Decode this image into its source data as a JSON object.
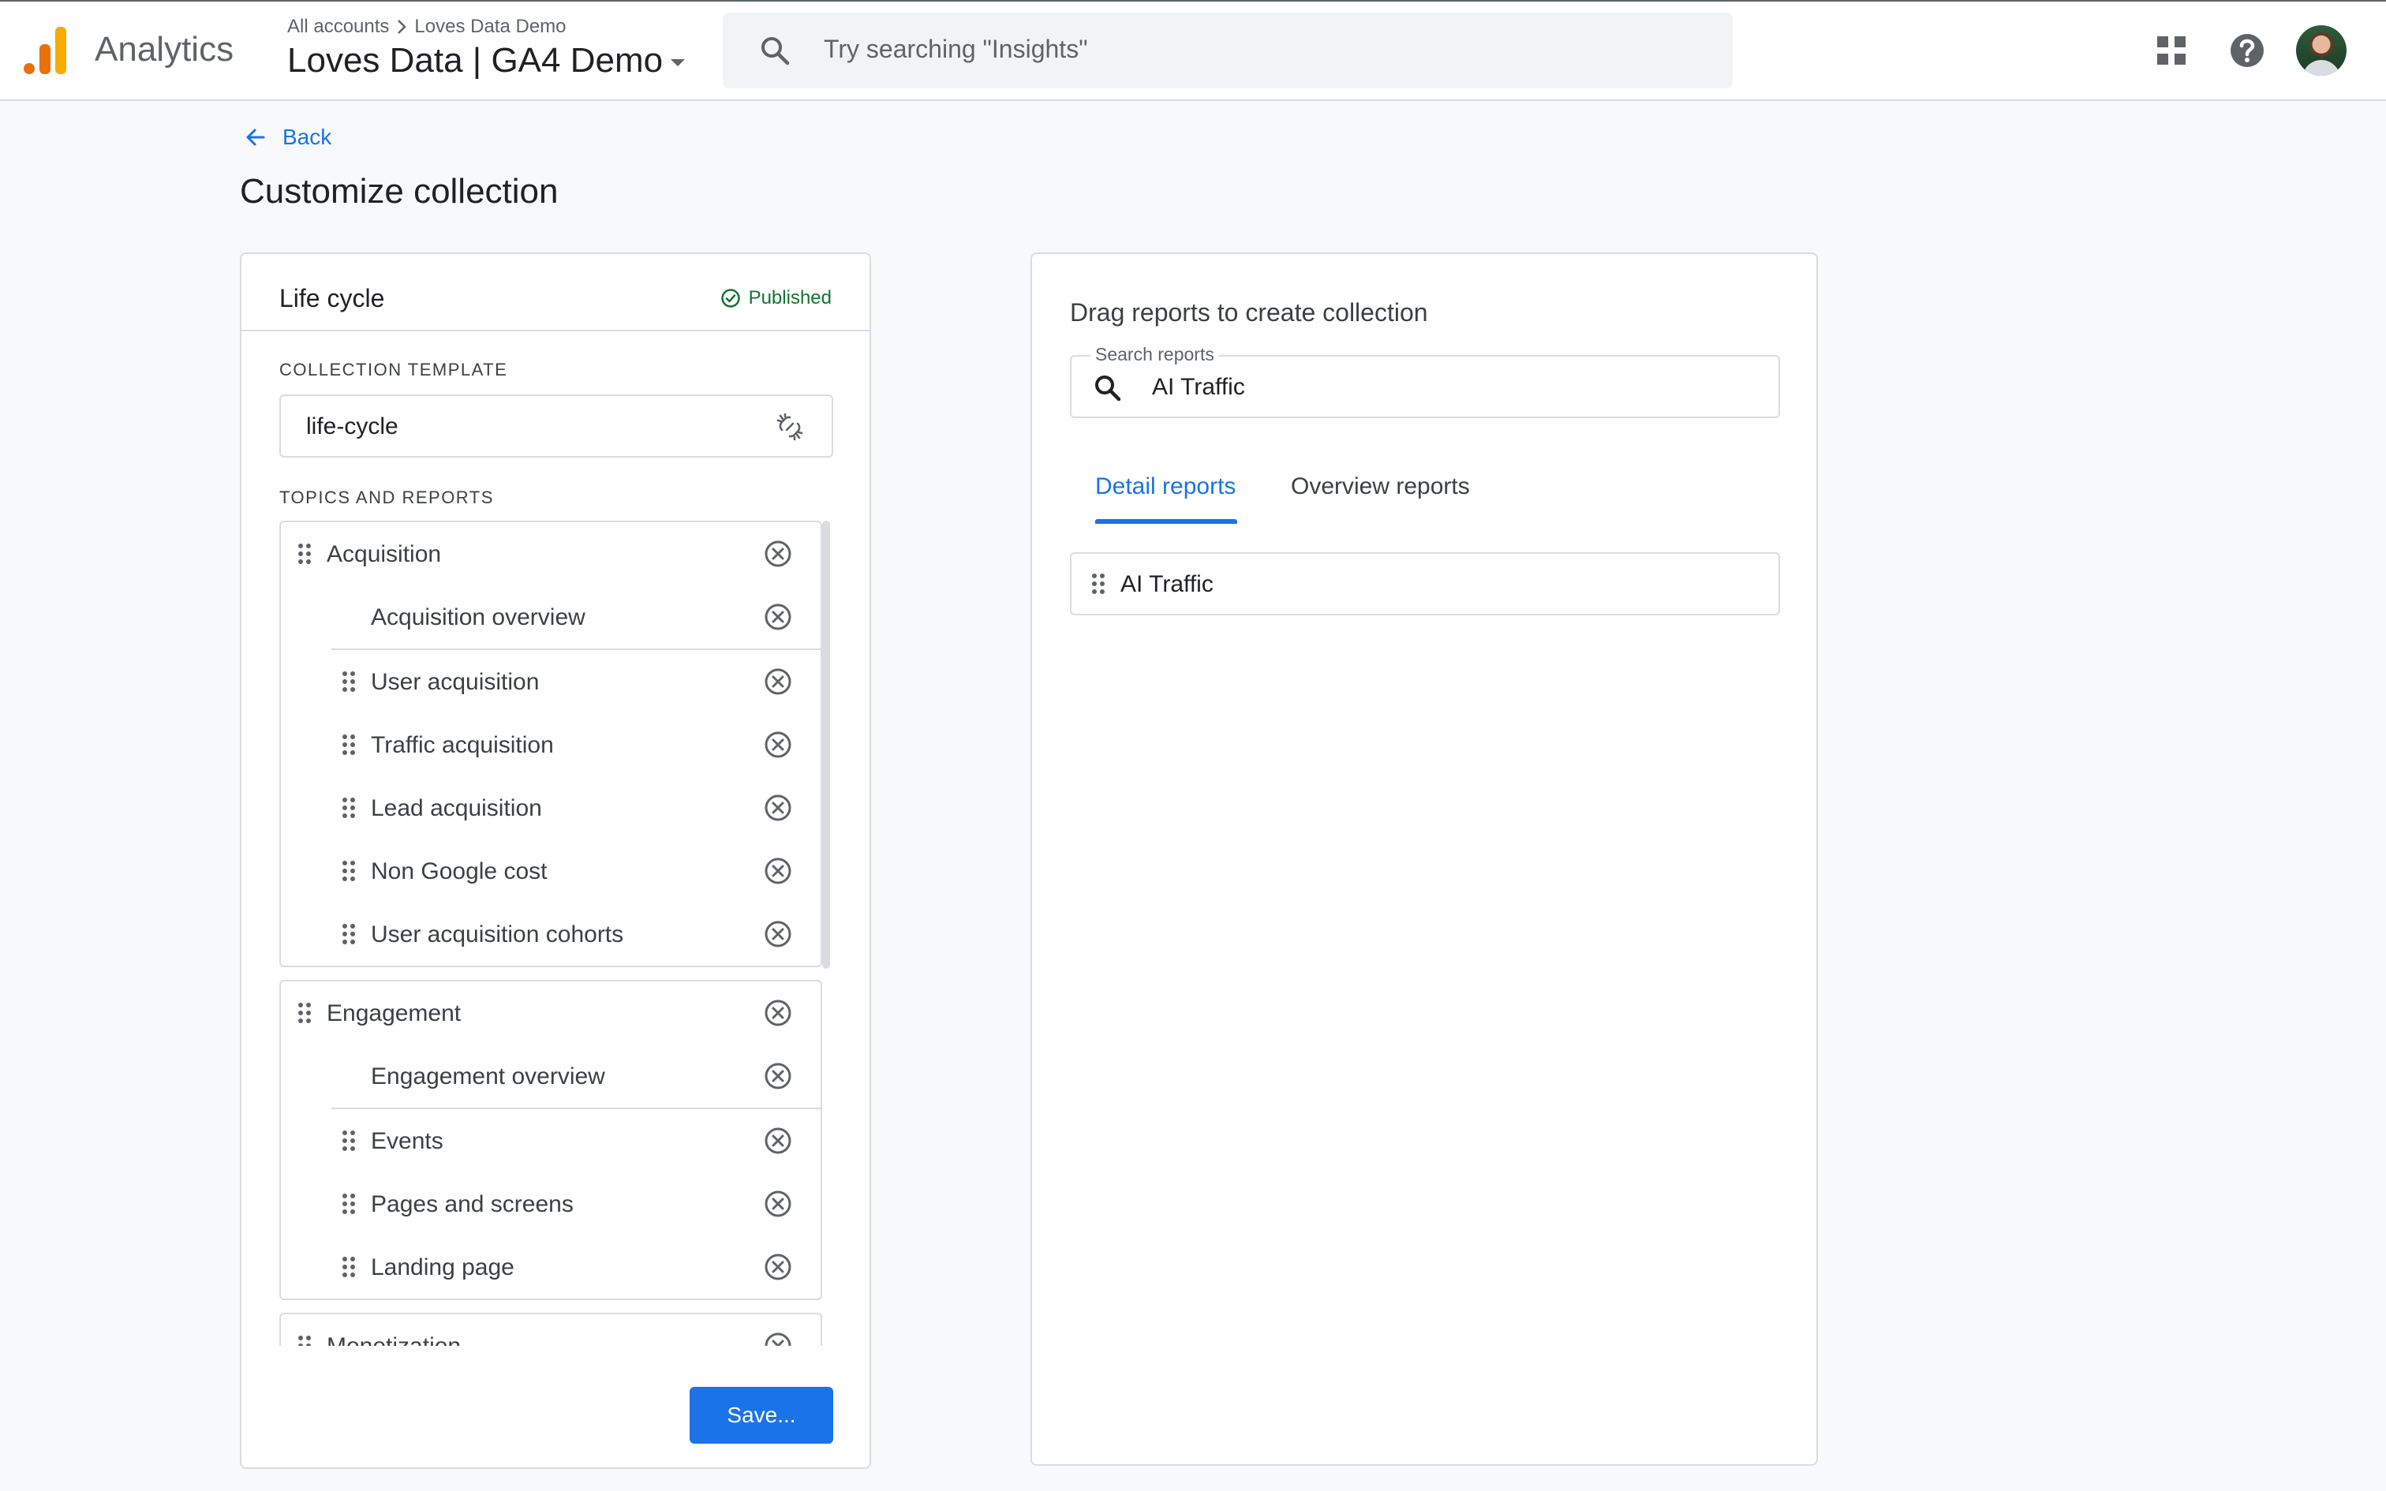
{
  "header": {
    "app_name": "Analytics",
    "breadcrumb": {
      "root": "All accounts",
      "current": "Loves Data Demo"
    },
    "property_name": "Loves Data | GA4 Demo",
    "search_placeholder": "Try searching \"Insights\"",
    "icons": [
      "analytics-logo",
      "search-icon",
      "apps-grid-icon",
      "help-icon",
      "avatar"
    ]
  },
  "page": {
    "back_label": "Back",
    "title": "Customize collection"
  },
  "collection": {
    "name": "Life cycle",
    "status": "Published",
    "template_label": "COLLECTION TEMPLATE",
    "template_value": "life-cycle",
    "topics_label": "TOPICS AND REPORTS",
    "topics": [
      {
        "name": "Acquisition",
        "overview": "Acquisition overview",
        "reports": [
          "User acquisition",
          "Traffic acquisition",
          "Lead acquisition",
          "Non Google cost",
          "User acquisition cohorts"
        ]
      },
      {
        "name": "Engagement",
        "overview": "Engagement overview",
        "reports": [
          "Events",
          "Pages and screens",
          "Landing page"
        ]
      },
      {
        "name": "Monetization",
        "overview": "",
        "reports": []
      }
    ],
    "save_label": "Save..."
  },
  "library": {
    "title": "Drag reports to create collection",
    "search_label": "Search reports",
    "search_value": "AI Traffic",
    "tabs": [
      {
        "label": "Detail reports",
        "active": true
      },
      {
        "label": "Overview reports",
        "active": false
      }
    ],
    "results": [
      "AI Traffic"
    ]
  },
  "colors": {
    "accent": "#1a73e8",
    "published": "#137333",
    "logo_orange": "#e8710a",
    "logo_yellow": "#f9ab00"
  }
}
